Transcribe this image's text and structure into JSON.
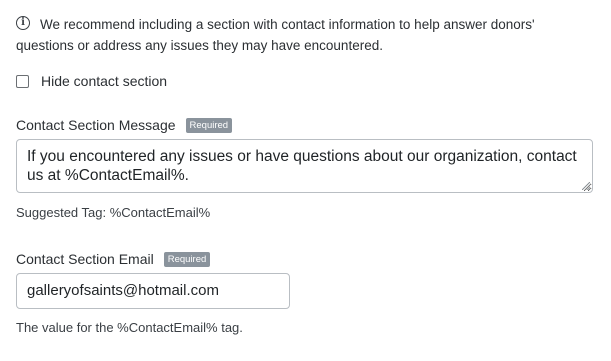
{
  "info": {
    "icon": "info-icon",
    "line1": "We recommend including a section with contact information to help answer donors'",
    "line2": "questions or address any issues they may have encountered."
  },
  "hide_contact": {
    "label": "Hide contact section",
    "checked": false
  },
  "contact_message": {
    "label": "Contact Section Message",
    "badge": "Required",
    "value": "If you encountered any issues or have questions about our organization, contact us at %ContactEmail%.",
    "hint": "Suggested Tag: %ContactEmail%"
  },
  "contact_email": {
    "label": "Contact Section Email",
    "badge": "Required",
    "value": "galleryofsaints@hotmail.com",
    "hint": "The value for the %ContactEmail% tag."
  }
}
